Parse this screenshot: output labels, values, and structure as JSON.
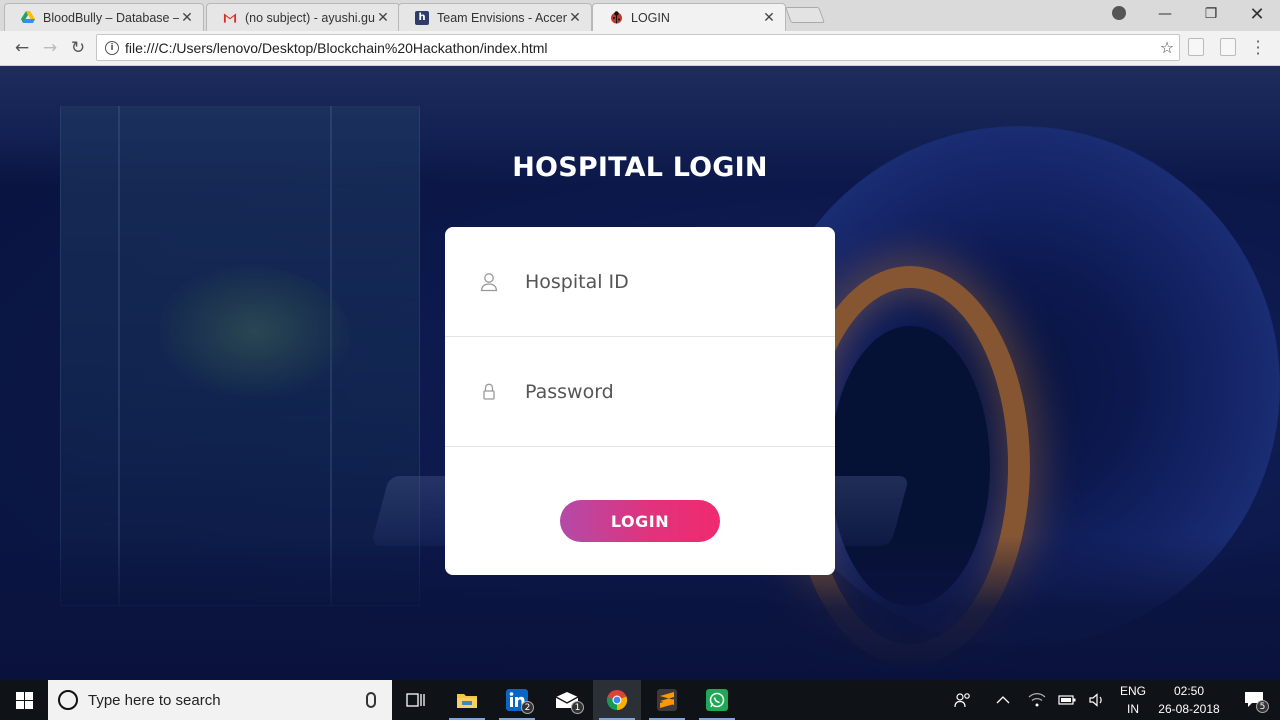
{
  "browser": {
    "tabs": [
      {
        "title": "BloodBully – Database – F",
        "favicon": "google-drive-icon",
        "color": "#f4b400"
      },
      {
        "title": "(no subject) - ayushi.gupt",
        "favicon": "gmail-icon",
        "color": "#d93025"
      },
      {
        "title": "Team Envisions - Accentu",
        "favicon": "hackerearth-icon",
        "color": "#2f3b69"
      },
      {
        "title": "LOGIN",
        "favicon": "ladybug-icon",
        "color": "#c0392b",
        "active": true
      }
    ],
    "url": "file:///C:/Users/lenovo/Desktop/Blockchain%20Hackathon/index.html"
  },
  "page": {
    "title": "HOSPITAL LOGIN",
    "form": {
      "hospital_id_placeholder": "Hospital ID",
      "password_placeholder": "Password",
      "login_label": "LOGIN"
    },
    "accent_gradient": [
      "#b34aa8",
      "#f02a6e"
    ]
  },
  "taskbar": {
    "search_placeholder": "Type here to search",
    "linkedin_badge": "2",
    "mail_badge": "1",
    "language_line1": "ENG",
    "language_line2": "IN",
    "time": "02:50",
    "date": "26-08-2018",
    "notification_count": "5"
  }
}
